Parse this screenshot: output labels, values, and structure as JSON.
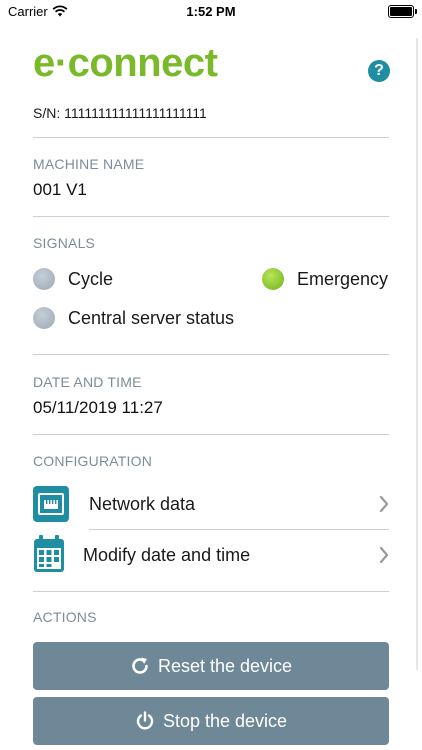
{
  "status_bar": {
    "carrier": "Carrier",
    "time": "1:52 PM"
  },
  "header": {
    "logo_text": "e·connect",
    "help_label": "?"
  },
  "device": {
    "serial": "S/N: 111111111111111111111"
  },
  "machine": {
    "label": "MACHINE NAME",
    "name": "001 V1"
  },
  "signals": {
    "label": "SIGNALS",
    "items": [
      {
        "name": "Cycle",
        "state_color": "#9ba8b6"
      },
      {
        "name": "Emergency",
        "state_color": "#6fb31b"
      },
      {
        "name": "Central server status",
        "state_color": "#9ba8b6"
      }
    ]
  },
  "datetime": {
    "label": "DATE AND TIME",
    "value": "05/11/2019 11:27"
  },
  "configuration": {
    "label": "CONFIGURATION",
    "items": [
      {
        "label": "Network data",
        "icon": "network-icon"
      },
      {
        "label": "Modify date and time",
        "icon": "calendar-icon"
      }
    ]
  },
  "actions": {
    "label": "ACTIONS",
    "reset_label": "Reset the device",
    "stop_label": "Stop the device"
  },
  "colors": {
    "brand_green": "#7ab929",
    "accent_teal": "#1f8ea3",
    "button_grey": "#6f8898"
  }
}
